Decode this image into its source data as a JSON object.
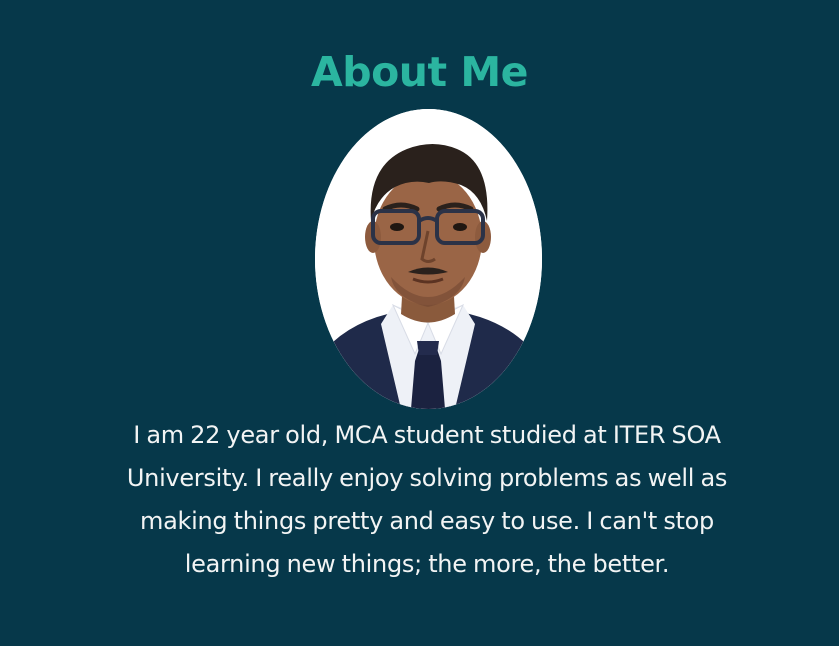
{
  "about": {
    "title": "About Me",
    "bio": "I am 22 year old, MCA student studied at ITER SOA University. I really enjoy solving problems as well as making things pretty and easy to use. I can't stop learning new things; the more, the better."
  },
  "colors": {
    "background": "#06384a",
    "title_accent": "#2bb5a0",
    "body_text": "#f2f4f4"
  }
}
